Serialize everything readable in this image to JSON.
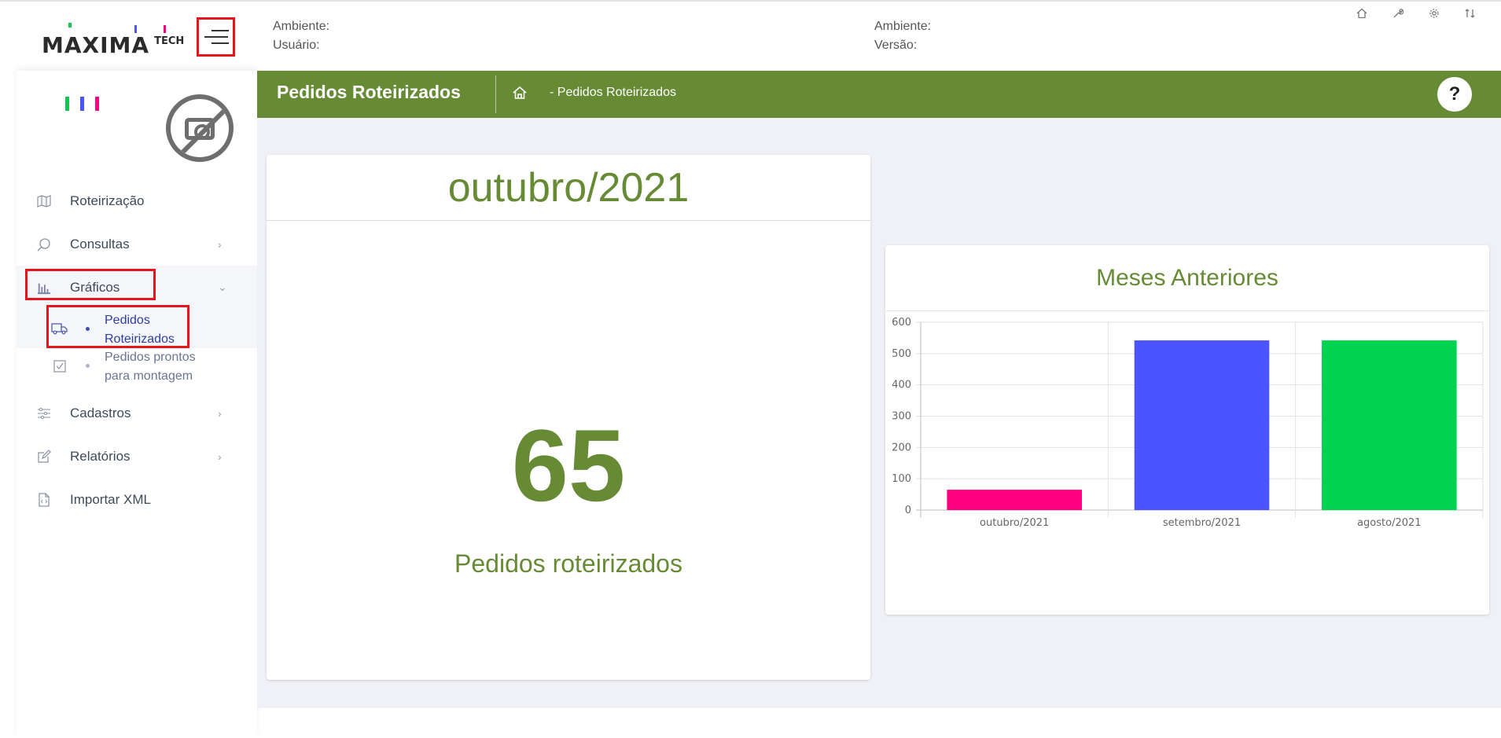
{
  "brand": {
    "logo_main": "MAXIMA",
    "logo_sub": "TECH"
  },
  "header": {
    "left_line1": "Ambiente:",
    "left_line2": "Usuário:",
    "right_line1": "Ambiente:",
    "right_line2": "Versão:",
    "icons": [
      "home-icon",
      "wrench-icon",
      "gear-icon",
      "shuffle-icon"
    ]
  },
  "sidebar": {
    "items": [
      {
        "label": "Roteirização",
        "icon": "map-icon"
      },
      {
        "label": "Consultas",
        "icon": "search-icon"
      },
      {
        "label": "Gráficos",
        "icon": "bar-chart-icon"
      },
      {
        "label": "Cadastros",
        "icon": "sliders-icon"
      },
      {
        "label": "Relatórios",
        "icon": "edit-icon"
      },
      {
        "label": "Importar XML",
        "icon": "file-code-icon"
      }
    ],
    "subitems": [
      {
        "label": "Pedidos Roteirizados",
        "icon": "truck-icon"
      },
      {
        "label": "Pedidos prontos para montagem",
        "icon": "checkbox-icon"
      }
    ]
  },
  "titlebar": {
    "title": "Pedidos Roteirizados",
    "breadcrumb": "- Pedidos Roteirizados",
    "help_label": "?"
  },
  "summary_card": {
    "month": "outubro/2021",
    "count": "65",
    "label": "Pedidos roteirizados"
  },
  "chart_card": {
    "title": "Meses Anteriores"
  },
  "chart_data": {
    "type": "bar",
    "title": "Meses Anteriores",
    "categories": [
      "outubro/2021",
      "setembro/2021",
      "agosto/2021"
    ],
    "values": [
      65,
      542,
      542
    ],
    "colors": [
      "#ff0080",
      "#4b55ff",
      "#00d34f"
    ],
    "ylim": [
      0,
      600
    ],
    "yticks": [
      0,
      100,
      200,
      300,
      400,
      500,
      600
    ],
    "xlabel": "",
    "ylabel": "",
    "grid": true,
    "legend": "none"
  },
  "colors": {
    "brand_green": "#668b34",
    "highlight_red": "#e8141c",
    "page_bg": "#f0f1f6"
  }
}
